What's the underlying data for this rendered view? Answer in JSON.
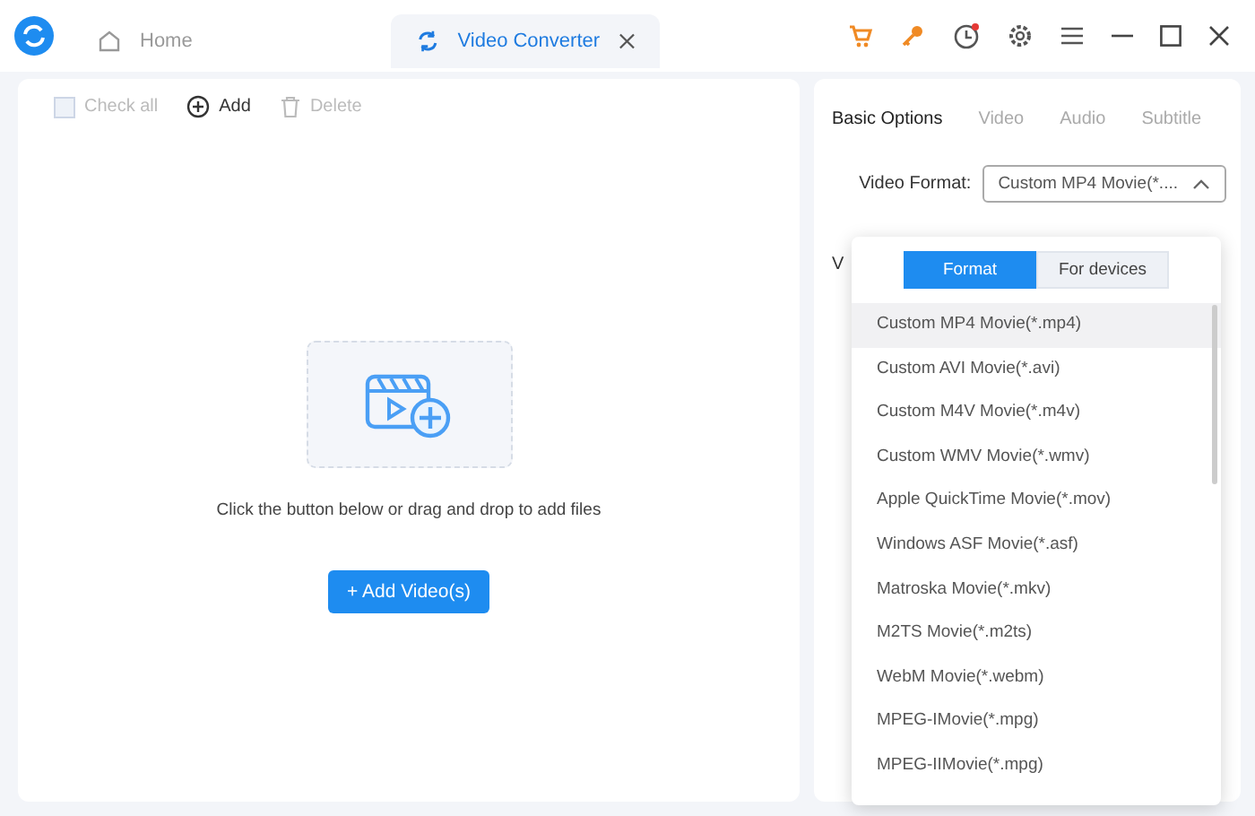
{
  "tabs": [
    {
      "label": "Home",
      "selected": false,
      "closable": false
    },
    {
      "label": "Video Converter",
      "selected": true,
      "closable": true
    }
  ],
  "toolbar": [
    {
      "kind": "checkbox",
      "label": "Check all",
      "disabled": true
    },
    {
      "kind": "add",
      "label": "Add",
      "disabled": false
    },
    {
      "kind": "delete",
      "label": "Delete",
      "disabled": true
    }
  ],
  "drop_area": {
    "hint": "Click the button below or drag and drop to add files",
    "button": "+ Add Video(s)"
  },
  "options_tabs": [
    {
      "label": "Basic Options",
      "selected": true
    },
    {
      "label": "Video",
      "selected": false
    },
    {
      "label": "Audio",
      "selected": false
    },
    {
      "label": "Subtitle",
      "selected": false
    }
  ],
  "video_format": {
    "label": "Video Format:",
    "value": "Custom MP4 Movie(*....",
    "expanded": true
  },
  "hidden_label": "V",
  "dropdown": {
    "modes": [
      {
        "label": "Format",
        "selected": true
      },
      {
        "label": "For devices",
        "selected": false
      }
    ],
    "options": [
      {
        "label": "Custom MP4 Movie(*.mp4)",
        "selected": true
      },
      {
        "label": "Custom AVI Movie(*.avi)",
        "selected": false
      },
      {
        "label": "Custom M4V Movie(*.m4v)",
        "selected": false
      },
      {
        "label": "Custom WMV Movie(*.wmv)",
        "selected": false
      },
      {
        "label": "Apple QuickTime Movie(*.mov)",
        "selected": false
      },
      {
        "label": "Windows ASF Movie(*.asf)",
        "selected": false
      },
      {
        "label": "Matroska Movie(*.mkv)",
        "selected": false
      },
      {
        "label": "M2TS Movie(*.m2ts)",
        "selected": false
      },
      {
        "label": "WebM Movie(*.webm)",
        "selected": false
      },
      {
        "label": "MPEG-IMovie(*.mpg)",
        "selected": false
      },
      {
        "label": "MPEG-IIMovie(*.mpg)",
        "selected": false
      }
    ]
  }
}
